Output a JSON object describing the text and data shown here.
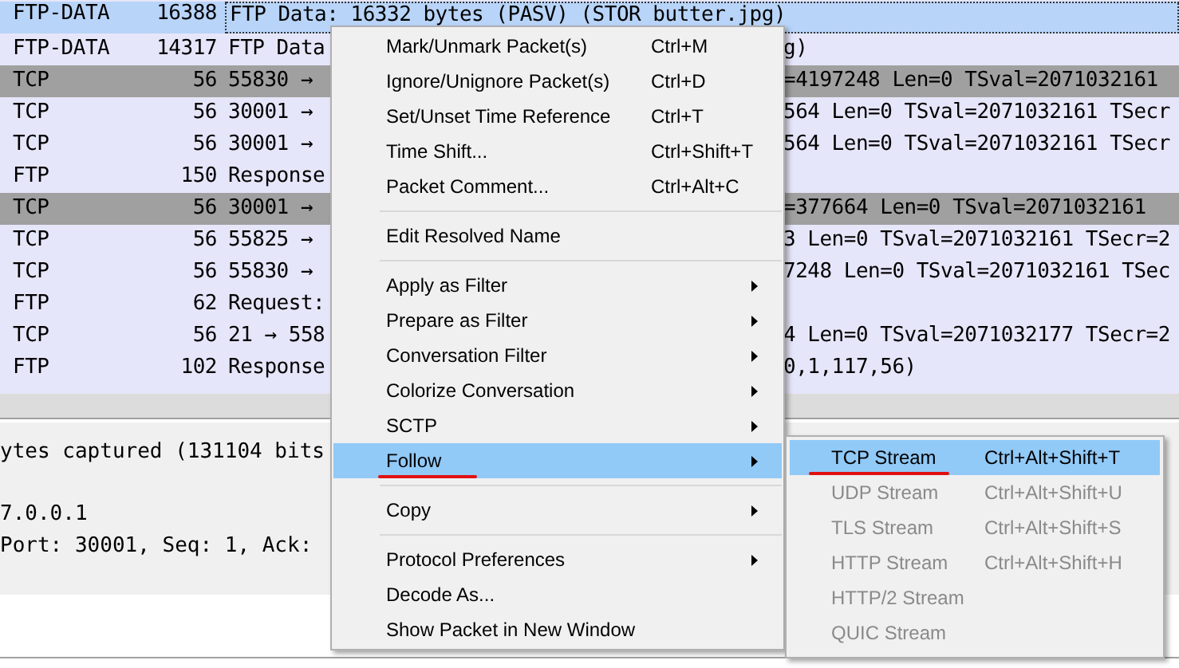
{
  "packet_list": {
    "rows": [
      {
        "protocol": "FTP-DATA",
        "length": "16388",
        "info": "FTP Data: 16332 bytes (PASV) (STOR butter.jpg)",
        "selected": true
      },
      {
        "protocol": "FTP-DATA",
        "length": "14317",
        "info": "FTP Data",
        "info_after_menu": "g)",
        "selected": false,
        "color": "#e6e6fa"
      },
      {
        "protocol": "TCP",
        "length": "56",
        "info": "55830 →",
        "info_after_menu": "=4197248 Len=0 TSval=2071032161",
        "selected": false,
        "color": "#a0a0a0"
      },
      {
        "protocol": "TCP",
        "length": "56",
        "info": "30001 →",
        "info_after_menu": "564 Len=0 TSval=2071032161 TSecr",
        "selected": false,
        "color": "#e6e6fa"
      },
      {
        "protocol": "TCP",
        "length": "56",
        "info": "30001 →",
        "info_after_menu": "564 Len=0 TSval=2071032161 TSecr",
        "selected": false,
        "color": "#e6e6fa"
      },
      {
        "protocol": "FTP",
        "length": "150",
        "info": "Response",
        "selected": false,
        "color": "#e6e6fa"
      },
      {
        "protocol": "TCP",
        "length": "56",
        "info": "30001 →",
        "info_after_menu": "=377664 Len=0 TSval=2071032161",
        "selected": false,
        "color": "#a0a0a0"
      },
      {
        "protocol": "TCP",
        "length": "56",
        "info": "55825 →",
        "info_after_menu": "3 Len=0 TSval=2071032161 TSecr=2",
        "selected": false,
        "color": "#e6e6fa"
      },
      {
        "protocol": "TCP",
        "length": "56",
        "info": "55830 →",
        "info_after_menu": "7248 Len=0 TSval=2071032161 TSec",
        "selected": false,
        "color": "#e6e6fa"
      },
      {
        "protocol": "FTP",
        "length": "62",
        "info": "Request:",
        "selected": false,
        "color": "#e6e6fa"
      },
      {
        "protocol": "TCP",
        "length": "56",
        "info": "21 → 558",
        "info_after_menu": "4 Len=0 TSval=2071032177 TSecr=2",
        "selected": false,
        "color": "#e6e6fa"
      },
      {
        "protocol": "FTP",
        "length": "102",
        "info": "Response",
        "info_after_menu": "0,1,117,56)",
        "selected": false,
        "color": "#e6e6fa"
      }
    ]
  },
  "packet_details": {
    "lines": [
      "ytes captured (131104 bits",
      "7.0.0.1",
      "Port: 30001, Seq: 1, Ack:"
    ]
  },
  "context_menu": {
    "items": [
      {
        "kind": "item",
        "label": "Mark/Unmark Packet(s)",
        "shortcut": "Ctrl+M",
        "submenu": false,
        "selected": false,
        "annotated": false
      },
      {
        "kind": "item",
        "label": "Ignore/Unignore Packet(s)",
        "shortcut": "Ctrl+D",
        "submenu": false,
        "selected": false,
        "annotated": false
      },
      {
        "kind": "item",
        "label": "Set/Unset Time Reference",
        "shortcut": "Ctrl+T",
        "submenu": false,
        "selected": false,
        "annotated": false
      },
      {
        "kind": "item",
        "label": "Time Shift...",
        "shortcut": "Ctrl+Shift+T",
        "submenu": false,
        "selected": false,
        "annotated": false
      },
      {
        "kind": "item",
        "label": "Packet Comment...",
        "shortcut": "Ctrl+Alt+C",
        "submenu": false,
        "selected": false,
        "annotated": false
      },
      {
        "kind": "separator"
      },
      {
        "kind": "item",
        "label": "Edit Resolved Name",
        "submenu": false,
        "selected": false,
        "annotated": false
      },
      {
        "kind": "separator"
      },
      {
        "kind": "item",
        "label": "Apply as Filter",
        "submenu": true,
        "selected": false,
        "annotated": false
      },
      {
        "kind": "item",
        "label": "Prepare as Filter",
        "submenu": true,
        "selected": false,
        "annotated": false
      },
      {
        "kind": "item",
        "label": "Conversation Filter",
        "submenu": true,
        "selected": false,
        "annotated": false
      },
      {
        "kind": "item",
        "label": "Colorize Conversation",
        "submenu": true,
        "selected": false,
        "annotated": false
      },
      {
        "kind": "item",
        "label": "SCTP",
        "submenu": true,
        "selected": false,
        "annotated": false
      },
      {
        "kind": "item",
        "label": "Follow",
        "submenu": true,
        "selected": true,
        "annotated": true
      },
      {
        "kind": "separator"
      },
      {
        "kind": "item",
        "label": "Copy",
        "submenu": true,
        "selected": false,
        "annotated": false
      },
      {
        "kind": "separator"
      },
      {
        "kind": "item",
        "label": "Protocol Preferences",
        "submenu": true,
        "selected": false,
        "annotated": false
      },
      {
        "kind": "item",
        "label": "Decode As...",
        "submenu": false,
        "selected": false,
        "annotated": false
      },
      {
        "kind": "item",
        "label": "Show Packet in New Window",
        "submenu": false,
        "selected": false,
        "annotated": false
      }
    ]
  },
  "follow_submenu": {
    "items": [
      {
        "label": "TCP Stream",
        "shortcut": "Ctrl+Alt+Shift+T",
        "selected": true,
        "disabled": false,
        "annotated": true
      },
      {
        "label": "UDP Stream",
        "shortcut": "Ctrl+Alt+Shift+U",
        "selected": false,
        "disabled": true,
        "annotated": false
      },
      {
        "label": "TLS Stream",
        "shortcut": "Ctrl+Alt+Shift+S",
        "selected": false,
        "disabled": true,
        "annotated": false
      },
      {
        "label": "HTTP Stream",
        "shortcut": "Ctrl+Alt+Shift+H",
        "selected": false,
        "disabled": true,
        "annotated": false
      },
      {
        "label": "HTTP/2 Stream",
        "selected": false,
        "disabled": true,
        "annotated": false
      },
      {
        "label": "QUIC Stream",
        "selected": false,
        "disabled": true,
        "annotated": false
      }
    ]
  }
}
